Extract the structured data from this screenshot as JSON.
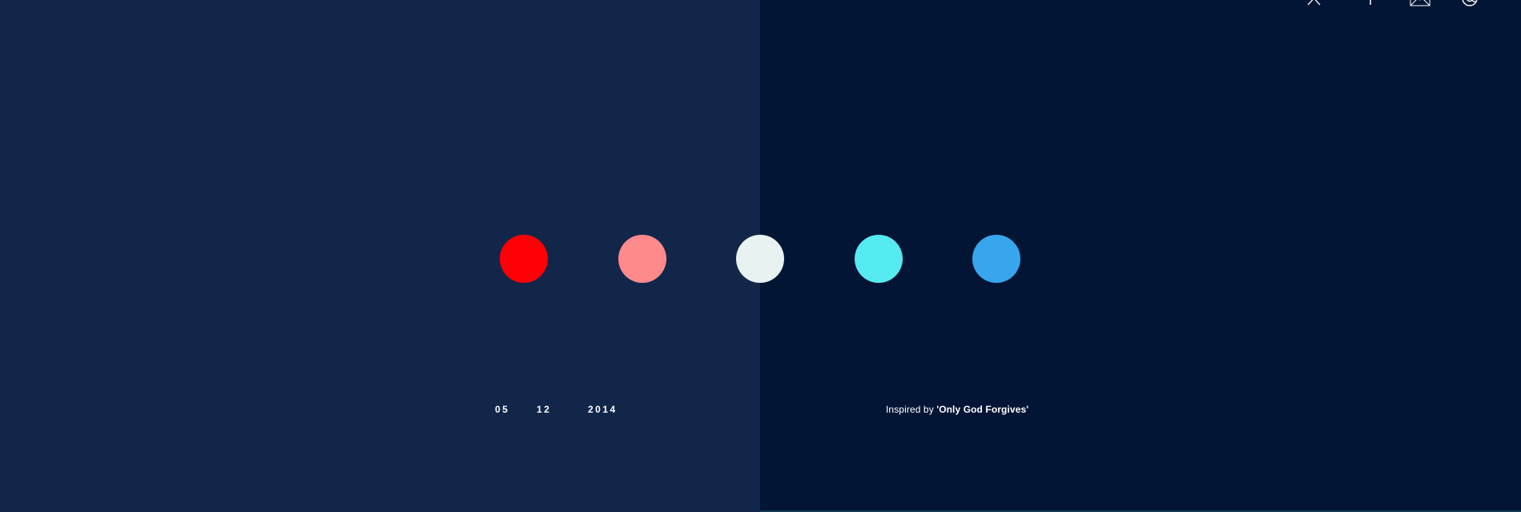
{
  "colors": {
    "panel_left": "#12264a",
    "panel_right": "#031535"
  },
  "palette": [
    {
      "hex": "#ff0007",
      "name": "red"
    },
    {
      "hex": "#ff8a8c",
      "name": "pink"
    },
    {
      "hex": "#e7f2f1",
      "name": "off-white"
    },
    {
      "hex": "#55eaf0",
      "name": "cyan"
    },
    {
      "hex": "#37a6ed",
      "name": "blue"
    }
  ],
  "date": {
    "day": "05",
    "month": "12",
    "year": "2014"
  },
  "credit": {
    "prefix": "Inspired by ",
    "title": "'Only God Forgives'"
  },
  "nav": [
    {
      "icon": "close-icon"
    },
    {
      "icon": "info-icon"
    },
    {
      "icon": "mail-icon"
    },
    {
      "icon": "at-icon"
    }
  ]
}
